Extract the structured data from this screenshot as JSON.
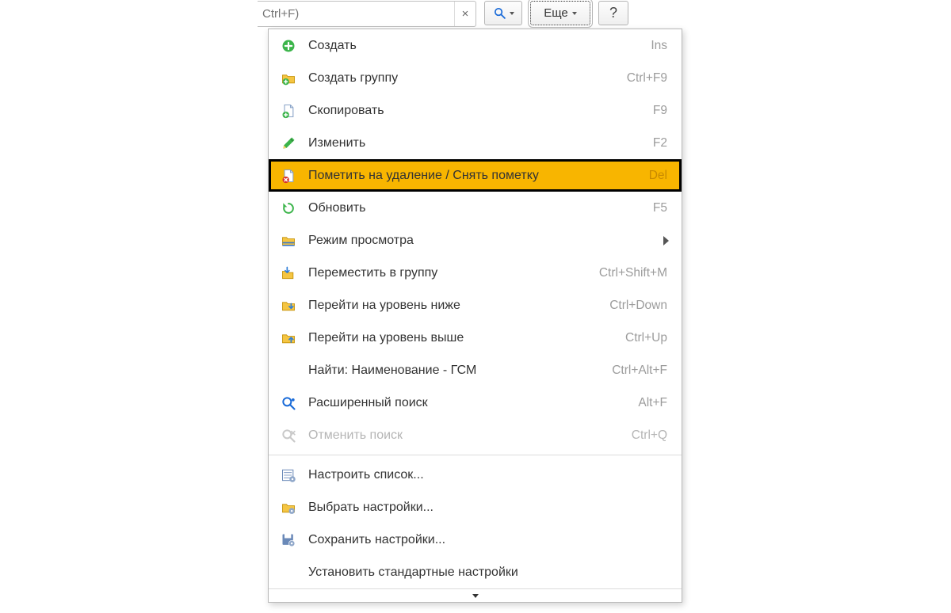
{
  "toolbar": {
    "search_placeholder": "Ctrl+F)",
    "more_label": "Еще",
    "help_label": "?"
  },
  "menu": {
    "items": [
      {
        "icon": "plus",
        "label": "Создать",
        "shortcut": "Ins"
      },
      {
        "icon": "folder-plus",
        "label": "Создать группу",
        "shortcut": "Ctrl+F9"
      },
      {
        "icon": "doc-plus",
        "label": "Скопировать",
        "shortcut": "F9"
      },
      {
        "icon": "pencil",
        "label": "Изменить",
        "shortcut": "F2"
      },
      {
        "icon": "doc-delete",
        "label": "Пометить на удаление / Снять пометку",
        "shortcut": "Del",
        "highlight": true
      },
      {
        "icon": "refresh",
        "label": "Обновить",
        "shortcut": "F5"
      },
      {
        "icon": "view-mode",
        "label": "Режим просмотра",
        "submenu": true
      },
      {
        "icon": "move-group",
        "label": "Переместить в группу",
        "shortcut": "Ctrl+Shift+M"
      },
      {
        "icon": "level-down",
        "label": "Перейти на уровень ниже",
        "shortcut": "Ctrl+Down"
      },
      {
        "icon": "level-up",
        "label": "Перейти на уровень выше",
        "shortcut": "Ctrl+Up"
      },
      {
        "icon": "none",
        "label": "Найти: Наименование - ГСМ",
        "shortcut": "Ctrl+Alt+F"
      },
      {
        "icon": "search-adv",
        "label": "Расширенный поиск",
        "shortcut": "Alt+F"
      },
      {
        "icon": "search-cancel",
        "label": "Отменить поиск",
        "shortcut": "Ctrl+Q",
        "disabled": true
      },
      {
        "sep": true
      },
      {
        "icon": "list-gear",
        "label": "Настроить список..."
      },
      {
        "icon": "folder-gear",
        "label": "Выбрать настройки..."
      },
      {
        "icon": "save-gear",
        "label": "Сохранить настройки..."
      },
      {
        "icon": "none",
        "label": "Установить стандартные настройки"
      }
    ]
  }
}
